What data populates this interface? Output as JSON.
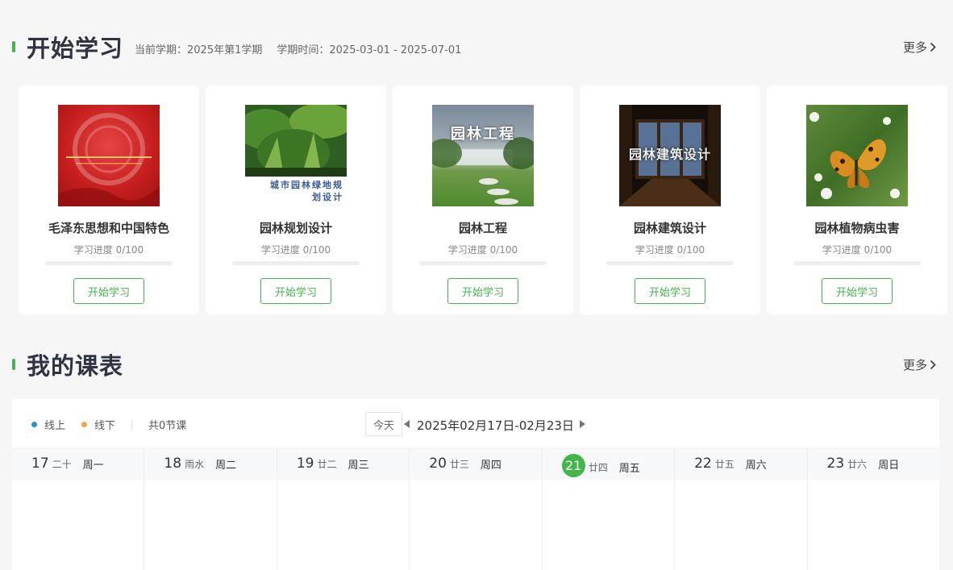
{
  "study": {
    "title": "开始学习",
    "term_label": "当前学期：2025年第1学期",
    "term_time": "学期时间：2025-03-01 - 2025-07-01",
    "more": "更多"
  },
  "courses": [
    {
      "name": "毛泽东思想和中国特色",
      "progress_text": "学习进度 0/100",
      "progress": 0,
      "button": "开始学习"
    },
    {
      "name": "园林规划设计",
      "cover_caption": "城市园林绿地规划设计",
      "progress_text": "学习进度 0/100",
      "progress": 0,
      "button": "开始学习"
    },
    {
      "name": "园林工程",
      "cover_caption": "园林工程",
      "progress_text": "学习进度 0/100",
      "progress": 0,
      "button": "开始学习"
    },
    {
      "name": "园林建筑设计",
      "cover_caption": "园林建筑设计",
      "progress_text": "学习进度 0/100",
      "progress": 0,
      "button": "开始学习"
    },
    {
      "name": "园林植物病虫害",
      "progress_text": "学习进度 0/100",
      "progress": 0,
      "button": "开始学习"
    }
  ],
  "schedule": {
    "title": "我的课表",
    "more": "更多",
    "legend_online": "线上",
    "legend_offline": "线下",
    "total": "共0节课",
    "today_button": "今天",
    "range": "2025年02月17日-02月23日",
    "colors": {
      "online": "#2a8fd1",
      "offline": "#f0a24e",
      "accent": "#44b549"
    },
    "days": [
      {
        "num": "17",
        "lunar": "二十",
        "week": "周一"
      },
      {
        "num": "18",
        "lunar": "雨水",
        "week": "周二"
      },
      {
        "num": "19",
        "lunar": "廿二",
        "week": "周三"
      },
      {
        "num": "20",
        "lunar": "廿三",
        "week": "周四"
      },
      {
        "num": "21",
        "lunar": "廿四",
        "week": "周五",
        "today": true
      },
      {
        "num": "22",
        "lunar": "廿五",
        "week": "周六"
      },
      {
        "num": "23",
        "lunar": "廿六",
        "week": "周日"
      }
    ]
  }
}
